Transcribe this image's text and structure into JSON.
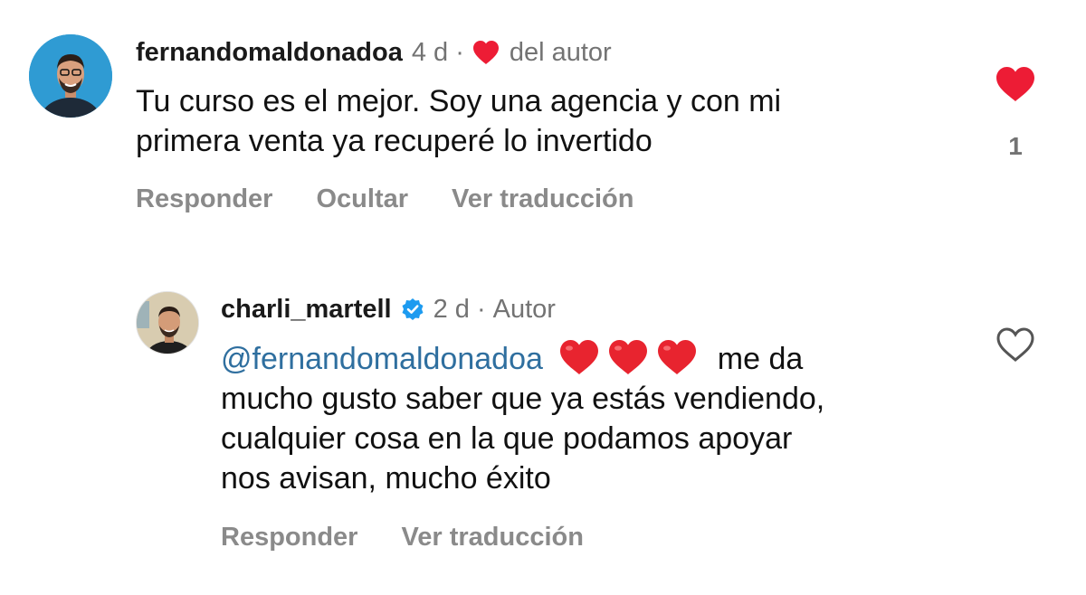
{
  "comments": [
    {
      "username": "fernandomaldonadoa",
      "time": "4 d",
      "separator": "·",
      "author_like_label": "del autor",
      "text_lines": [
        "Tu curso es el mejor. Soy una agencia y con mi",
        "primera venta ya recuperé lo invertido"
      ],
      "actions": {
        "reply": "Responder",
        "hide": "Ocultar",
        "translate": "Ver traducción"
      },
      "liked": true,
      "like_count": "1",
      "icons": {
        "avatar": "profile-photo",
        "author_heart": "heart-filled-icon",
        "like": "heart-filled-icon"
      }
    },
    {
      "username": "charli_martell",
      "verified": true,
      "time": "2 d",
      "separator": "·",
      "role": "Autor",
      "mention": "@fernandomaldonadoa",
      "emojis": [
        "❤️",
        "❤️",
        "❤️"
      ],
      "text_lines": [
        "me da",
        "mucho gusto saber que ya estás vendiendo,",
        "cualquier cosa en la que podamos apoyar",
        "nos avisan, mucho éxito"
      ],
      "actions": {
        "reply": "Responder",
        "translate": "Ver traducción"
      },
      "liked": false,
      "icons": {
        "avatar": "profile-photo",
        "verified": "verified-badge-icon",
        "like": "heart-outline-icon"
      }
    }
  ],
  "colors": {
    "heart_red": "#ed1c35",
    "mention_blue": "#2f6f9f",
    "verified_blue": "#1d9bf0",
    "muted_gray": "#737373",
    "action_gray": "#8a8a8a"
  }
}
